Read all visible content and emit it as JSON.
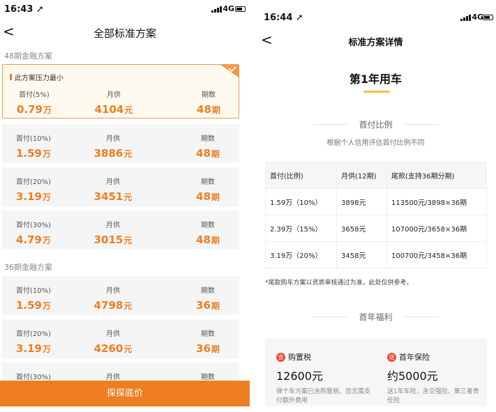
{
  "left_screen": {
    "status": {
      "time": "16:43",
      "network": "4G"
    },
    "title": "全部标准方案",
    "section_48": "48期金融方案",
    "section_36": "36期金融方案",
    "selected_tip": "此方案压力最小",
    "col_labels": {
      "down": "首付",
      "monthly": "月供",
      "term": "期数"
    },
    "plans_48": [
      {
        "down_label": "首付(5%)",
        "down_value": "0.79",
        "down_unit": "万",
        "monthly_label": "月供",
        "monthly_value": "4104",
        "monthly_unit": "元",
        "term_label": "期数",
        "term_value": "48",
        "term_unit": "期"
      },
      {
        "down_label": "首付(10%)",
        "down_value": "1.59",
        "down_unit": "万",
        "monthly_label": "月供",
        "monthly_value": "3886",
        "monthly_unit": "元",
        "term_label": "期数",
        "term_value": "48",
        "term_unit": "期"
      },
      {
        "down_label": "首付(20%)",
        "down_value": "3.19",
        "down_unit": "万",
        "monthly_label": "月供",
        "monthly_value": "3451",
        "monthly_unit": "元",
        "term_label": "期数",
        "term_value": "48",
        "term_unit": "期"
      },
      {
        "down_label": "首付(30%)",
        "down_value": "4.79",
        "down_unit": "万",
        "monthly_label": "月供",
        "monthly_value": "3015",
        "monthly_unit": "元",
        "term_label": "期数",
        "term_value": "48",
        "term_unit": "期"
      }
    ],
    "plans_36": [
      {
        "down_label": "首付(10%)",
        "down_value": "1.59",
        "down_unit": "万",
        "monthly_label": "月供",
        "monthly_value": "4798",
        "monthly_unit": "元",
        "term_label": "期数",
        "term_value": "36",
        "term_unit": "期"
      },
      {
        "down_label": "首付(20%)",
        "down_value": "3.19",
        "down_unit": "万",
        "monthly_label": "月供",
        "monthly_value": "4260",
        "monthly_unit": "元",
        "term_label": "期数",
        "term_value": "36",
        "term_unit": "期"
      },
      {
        "down_label": "首付(30%)",
        "monthly_label": "月供",
        "term_label": "期数"
      }
    ],
    "bottom_button": "探探底价"
  },
  "right_screen": {
    "status": {
      "time": "16:44",
      "network": "4G"
    },
    "title": "标准方案详情",
    "year_title": "第1年用车",
    "down_section": "首付比例",
    "down_subtitle": "根据个人信用评估首付比例不同",
    "table": {
      "headers": [
        "首付(比例)",
        "月供(12期)",
        "尾款(支持36期分期)"
      ],
      "rows": [
        [
          "1.59万（10%）",
          "3898元",
          "113500元/3898×36期"
        ],
        [
          "2.39万（15%）",
          "3658元",
          "107000元/3658×36期"
        ],
        [
          "3.19万（20%）",
          "3458元",
          "100700元/3458×36期"
        ]
      ]
    },
    "note": "*尾款购车方案以资质审核通过为准，此处仅供参考。",
    "benefit_section": "首年福利",
    "benefits": [
      {
        "badge": "含",
        "name": "购置税",
        "amount": "12600元",
        "desc": "弹个车方案已含购置税，您无需支付额外费用"
      },
      {
        "badge": "送",
        "name": "首年保险",
        "amount": "约5000元",
        "desc": "送1年车险，含交强险、第三者责任险"
      }
    ]
  },
  "colors": {
    "accent": "#ef7d22",
    "gold": "#f2c43a",
    "badge_red": "#ef4b3c"
  },
  "icons": [
    "back-arrow-icon",
    "signal-icon",
    "battery-icon",
    "location-arrow-icon",
    "checkmark-icon"
  ]
}
